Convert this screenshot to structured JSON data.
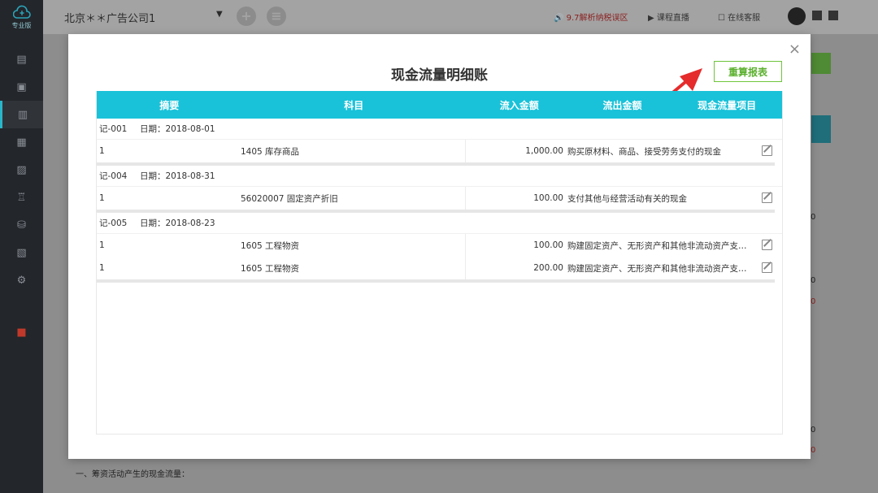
{
  "sidebar": {
    "logo_tag": "专业版"
  },
  "topbar": {
    "company": "北京＊＊广告公司1",
    "notice": "9.7解析纳税误区",
    "live": "课程直播",
    "service": "在线客服"
  },
  "background": {
    "numbers": [
      "0",
      "0",
      "0",
      "0",
      "0"
    ],
    "footer_text": "一、筹资活动产生的现金流量："
  },
  "modal": {
    "title": "现金流量明细账",
    "recalc_label": "重算报表",
    "close_label": "×",
    "columns": [
      "摘要",
      "科目",
      "流入金额",
      "流出金额",
      "现金流量项目"
    ],
    "groups": [
      {
        "voucher": "记-001",
        "date": "日期：2018-08-01",
        "lines": [
          {
            "summary": "1",
            "subject": "1405 库存商品",
            "amount": "1,000.00",
            "item": "购买原材料、商品、接受劳务支付的现金"
          }
        ]
      },
      {
        "voucher": "记-004",
        "date": "日期：2018-08-31",
        "lines": [
          {
            "summary": "1",
            "subject": "56020007 固定资产折旧",
            "amount": "100.00",
            "item": "支付其他与经营活动有关的现金"
          }
        ]
      },
      {
        "voucher": "记-005",
        "date": "日期：2018-08-23",
        "lines": [
          {
            "summary": "1",
            "subject": "1605 工程物资",
            "amount": "100.00",
            "item": "购建固定资产、无形资产和其他非流动资产支付..."
          },
          {
            "summary": "1",
            "subject": "1605 工程物资",
            "amount": "200.00",
            "item": "购建固定资产、无形资产和其他非流动资产支付..."
          }
        ]
      }
    ]
  },
  "colors": {
    "header_bg": "#19c2d9",
    "button_green": "#5cb02f",
    "arrow_red": "#e52b2b",
    "sidebar_bg": "#23262b"
  }
}
